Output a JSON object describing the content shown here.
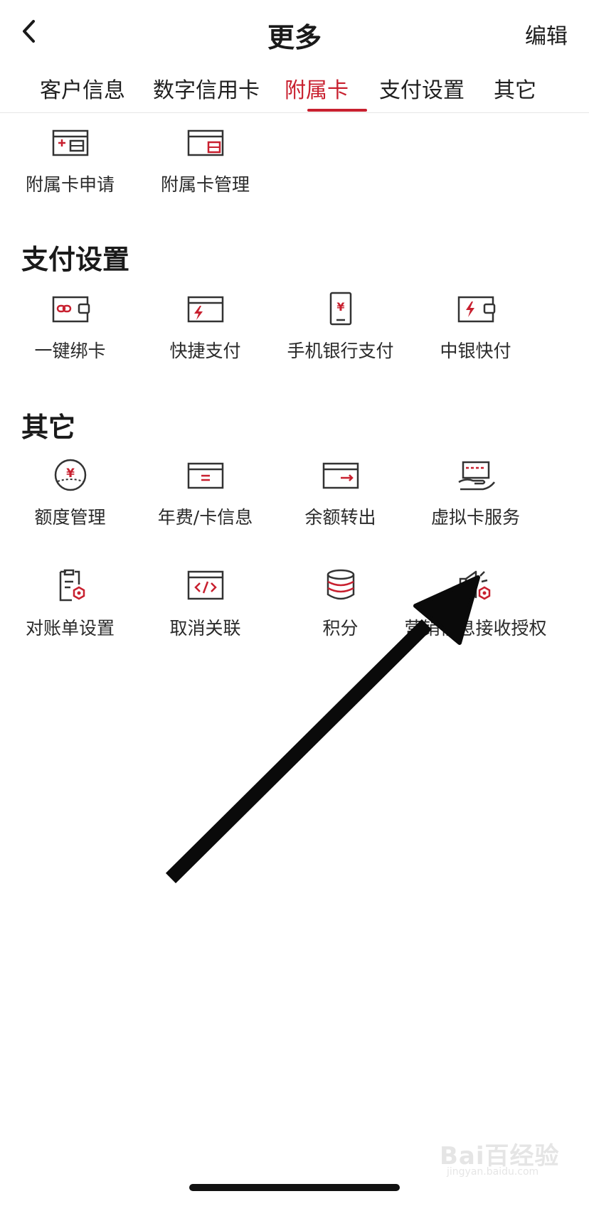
{
  "header": {
    "title": "更多",
    "edit_label": "编辑",
    "back_icon": "chevron-left-icon"
  },
  "tabs": [
    {
      "label": "客户信息",
      "active": false
    },
    {
      "label": "数字信用卡",
      "active": false
    },
    {
      "label": "附属卡",
      "active": true
    },
    {
      "label": "支付设置",
      "active": false
    },
    {
      "label": "其它",
      "active": false
    }
  ],
  "sections": {
    "supplementary": {
      "items": [
        {
          "label": "附属卡申请",
          "icon": "card-add-icon"
        },
        {
          "label": "附属卡管理",
          "icon": "card-manage-icon"
        }
      ]
    },
    "payment": {
      "title": "支付设置",
      "items": [
        {
          "label": "一键绑卡",
          "icon": "card-link-icon"
        },
        {
          "label": "快捷支付",
          "icon": "card-lightning-icon"
        },
        {
          "label": "手机银行支付",
          "icon": "phone-yen-icon"
        },
        {
          "label": "中银快付",
          "icon": "wallet-lightning-icon"
        }
      ]
    },
    "other": {
      "title": "其它",
      "items": [
        {
          "label": "额度管理",
          "icon": "yen-circle-icon"
        },
        {
          "label": "年费/卡信息",
          "icon": "card-info-icon"
        },
        {
          "label": "余额转出",
          "icon": "card-transfer-icon"
        },
        {
          "label": "虚拟卡服务",
          "icon": "hand-card-icon"
        },
        {
          "label": "对账单设置",
          "icon": "statement-settings-icon"
        },
        {
          "label": "取消关联",
          "icon": "code-unlink-icon"
        },
        {
          "label": "积分",
          "icon": "coins-stack-icon"
        },
        {
          "label": "营销信息接收授权",
          "icon": "speaker-settings-icon"
        }
      ]
    }
  },
  "watermark": {
    "text": "Bai百经验",
    "sub": "jingyan.baidu.com"
  },
  "colors": {
    "accent": "#c8202f",
    "text": "#222222",
    "icon_stroke": "#333333"
  }
}
